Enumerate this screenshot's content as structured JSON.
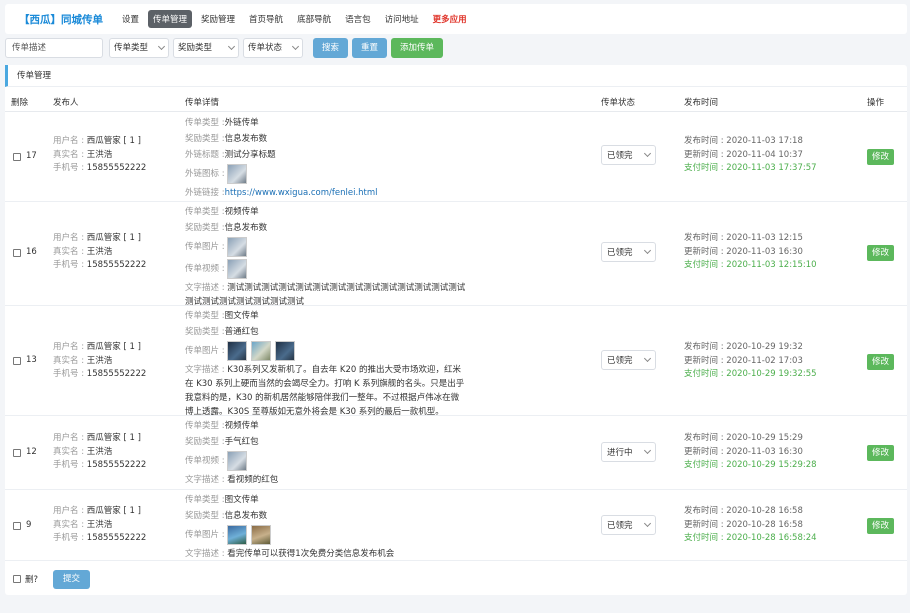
{
  "header": {
    "brand": "【西瓜】同城传单",
    "nav": [
      "设置",
      "传单管理",
      "奖励管理",
      "首页导航",
      "底部导航",
      "语言包",
      "访问地址",
      "更多应用"
    ]
  },
  "filters": {
    "desc_placeholder": "传单描述",
    "type": "传单类型",
    "reward": "奖励类型",
    "status": "传单状态",
    "search": "搜索",
    "reset": "重置",
    "add": "添加传单"
  },
  "panel": {
    "title": "传单管理",
    "columns": [
      "删除",
      "发布人",
      "传单详情",
      "传单状态",
      "发布时间",
      "操作"
    ]
  },
  "rows": [
    {
      "id": "17",
      "user": "西瓜管家 [ 1 ]",
      "realname": "王洪浩",
      "phone": "15855552222",
      "type": "外链传单",
      "reward": "信息发布数",
      "link_title": "测试分享标题",
      "link_url": "https://www.wxigua.com/fenlei.html",
      "status": "已领完",
      "published": "2020-11-03 17:18",
      "updated": "2020-11-04 10:37",
      "paid": "2020-11-03 17:37:57"
    },
    {
      "id": "16",
      "user": "西瓜管家 [ 1 ]",
      "realname": "王洪浩",
      "phone": "15855552222",
      "type": "视频传单",
      "reward": "信息发布数",
      "text": "测试测试测试测试测试测试测试测试测试测试测试测试测试测试测试测试测试测试测试测试测试",
      "status": "已领完",
      "published": "2020-11-03 12:15",
      "updated": "2020-11-03 16:30",
      "paid": "2020-11-03 12:15:10"
    },
    {
      "id": "13",
      "user": "西瓜管家 [ 1 ]",
      "realname": "王洪浩",
      "phone": "15855552222",
      "type": "图文传单",
      "reward": "普通红包",
      "text": "K30系列又发新机了。自去年 K20 的推出大受市场欢迎，红米在 K30 系列上硬而当然的会竭尽全力。打响 K 系列旗舰的名头。只是出乎我意料的是，K30 的新机居然能够陪伴我们一整年。不过根据卢伟冰在微博上透露。K30S 至尊版如无意外将会是 K30 系列的最后一款机型。",
      "status": "已领完",
      "published": "2020-10-29 19:32",
      "updated": "2020-11-02 17:03",
      "paid": "2020-10-29 19:32:55"
    },
    {
      "id": "12",
      "user": "西瓜管家 [ 1 ]",
      "realname": "王洪浩",
      "phone": "15855552222",
      "type": "视频传单",
      "reward": "手气红包",
      "text": "看视频的红包",
      "status": "进行中",
      "published": "2020-10-29 15:29",
      "updated": "2020-11-03 16:30",
      "paid": "2020-10-29 15:29:28"
    },
    {
      "id": "9",
      "user": "西瓜管家 [ 1 ]",
      "realname": "王洪浩",
      "phone": "15855552222",
      "type": "图文传单",
      "reward": "信息发布数",
      "text": "看完传单可以获得1次免费分类信息发布机会",
      "status": "已领完",
      "published": "2020-10-28 16:58",
      "updated": "2020-10-28 16:58",
      "paid": "2020-10-28 16:58:24"
    }
  ],
  "labels": {
    "username": "用户名 : ",
    "realname": "真实名 : ",
    "phone": "手机号 : ",
    "type": "传单类型 : ",
    "reward": "奖励类型 : ",
    "link_title": "外链标题 : ",
    "link_icon": "外链图标 : ",
    "link_url": "外链链接 : ",
    "images": "传单图片 : ",
    "video": "传单视频 : ",
    "text": "文字描述 : ",
    "published": "发布时间 : ",
    "updated": "更新时间 : ",
    "paid": "支付时间 : ",
    "edit": "修改"
  },
  "footer": {
    "delete_label": "删?",
    "submit": "提交"
  },
  "icons": [
    "chevron-down-icon",
    "checkbox-icon"
  ]
}
